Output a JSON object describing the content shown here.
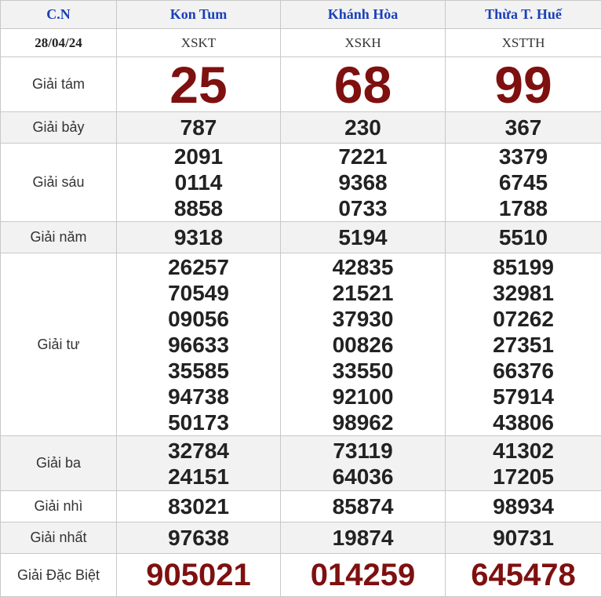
{
  "header": {
    "day_label": "C.N",
    "date": "28/04/24",
    "provinces": [
      "Kon Tum",
      "Khánh Hòa",
      "Thừa T. Huế"
    ],
    "codes": [
      "XSKT",
      "XSKH",
      "XSTTH"
    ]
  },
  "prizes": {
    "tam": {
      "label": "Giải tám",
      "values": [
        "25",
        "68",
        "99"
      ]
    },
    "bay": {
      "label": "Giải bảy",
      "values": [
        "787",
        "230",
        "367"
      ]
    },
    "sau": {
      "label": "Giải sáu",
      "values": [
        [
          "2091",
          "0114",
          "8858"
        ],
        [
          "7221",
          "9368",
          "0733"
        ],
        [
          "3379",
          "6745",
          "1788"
        ]
      ]
    },
    "nam": {
      "label": "Giải năm",
      "values": [
        "9318",
        "5194",
        "5510"
      ]
    },
    "tu": {
      "label": "Giải tư",
      "values": [
        [
          "26257",
          "70549",
          "09056",
          "96633",
          "35585",
          "94738",
          "50173"
        ],
        [
          "42835",
          "21521",
          "37930",
          "00826",
          "33550",
          "92100",
          "98962"
        ],
        [
          "85199",
          "32981",
          "07262",
          "27351",
          "66376",
          "57914",
          "43806"
        ]
      ]
    },
    "ba": {
      "label": "Giải ba",
      "values": [
        [
          "32784",
          "24151"
        ],
        [
          "73119",
          "64036"
        ],
        [
          "41302",
          "17205"
        ]
      ]
    },
    "nhi": {
      "label": "Giải nhì",
      "values": [
        "83021",
        "85874",
        "98934"
      ]
    },
    "nhat": {
      "label": "Giải nhất",
      "values": [
        "97638",
        "19874",
        "90731"
      ]
    },
    "dacbiet": {
      "label": "Giải Đặc Biệt",
      "values": [
        "905021",
        "014259",
        "645478"
      ]
    }
  }
}
